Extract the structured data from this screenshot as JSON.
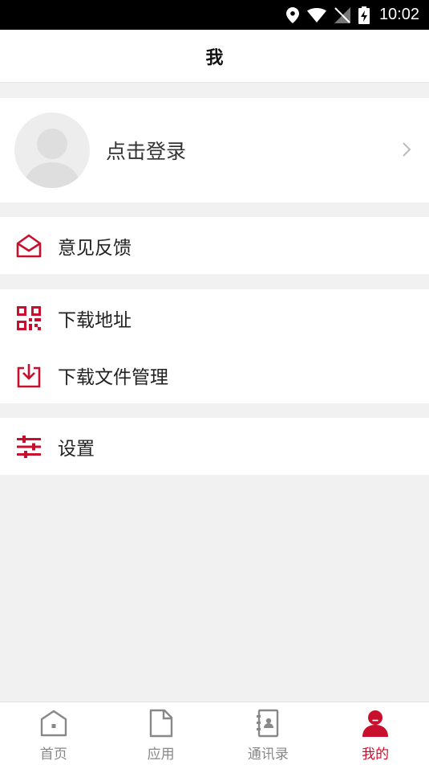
{
  "status_bar": {
    "time": "10:02"
  },
  "header": {
    "title": "我"
  },
  "profile": {
    "login_label": "点击登录"
  },
  "menu": {
    "feedback": "意见反馈",
    "download_address": "下载地址",
    "download_manager": "下载文件管理",
    "settings": "设置"
  },
  "tabs": [
    {
      "label": "首页",
      "icon": "home-icon"
    },
    {
      "label": "应用",
      "icon": "document-icon"
    },
    {
      "label": "通讯录",
      "icon": "contacts-icon"
    },
    {
      "label": "我的",
      "icon": "user-icon",
      "active": true
    }
  ],
  "colors": {
    "accent": "#c8102e",
    "background": "#f1f1f1"
  }
}
